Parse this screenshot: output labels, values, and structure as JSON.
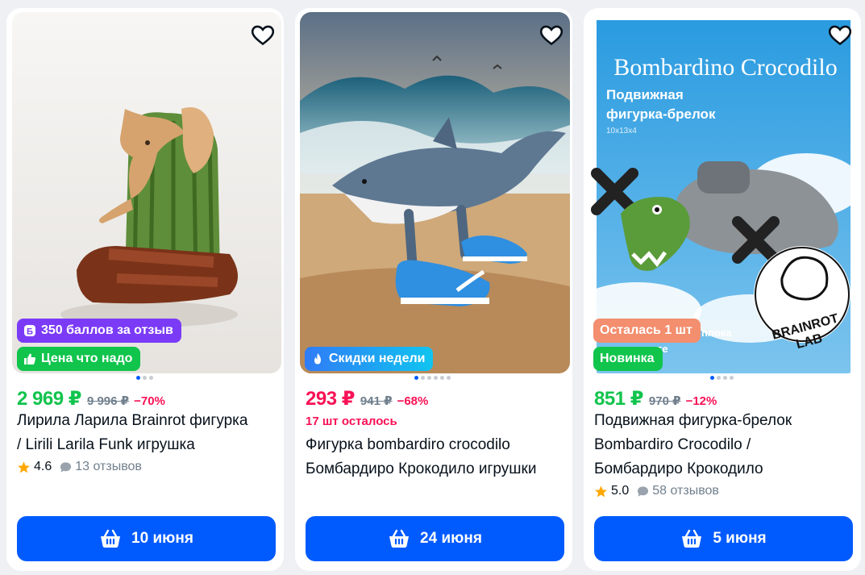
{
  "colors": {
    "accent": "#005bff",
    "price_green": "#10c44c",
    "price_pink": "#f91155",
    "badge_points": "#7b3bf6",
    "badge_good_price": "#10c44c",
    "badge_sale": "#10a7f0",
    "badge_left": "#f38e6e",
    "badge_new": "#10c44c"
  },
  "products": [
    {
      "price": "2 969 ₽",
      "old_price": "9 996 ₽",
      "discount": "−70%",
      "title_line1": "Лирила Ларила Brainrot фигурка",
      "title_line2": "/ Lirili Larila Funk игрушка",
      "rating": "4.6",
      "reviews": "13 отзывов",
      "badge_top": "350 баллов за отзыв",
      "badge_bottom": "Цена что надо",
      "delivery": "10 июня",
      "image_dots_active": 1,
      "image_dots_total": 3
    },
    {
      "price": "293 ₽",
      "old_price": "941 ₽",
      "discount": "−68%",
      "stock_left": "17 шт осталось",
      "title_line1": "Фигурка bombardiro crocodilo",
      "title_line2": "Бомбардиро Крокодило игрушки",
      "badge_bottom": "Скидки недели",
      "delivery": "24 июня",
      "image_dots_active": 1,
      "image_dots_total": 6
    },
    {
      "price": "851 ₽",
      "old_price": "970 ₽",
      "discount": "−12%",
      "title_line1": "Подвижная фигурка-брелок",
      "title_line2": "Bombardiro Crocodilo /",
      "title_line3": "Бомбардиро Крокодило",
      "rating": "5.0",
      "reviews": "58 отзывов",
      "badge_top": "Осталась 1 шт",
      "badge_bottom": "Новинка",
      "delivery": "5 июня",
      "image_dots_active": 1,
      "image_dots_total": 4,
      "image_text": {
        "heading": "Bombardino Crocodilo",
        "sub": "Подвижная фигурка-брелок",
        "size": "10x13x4",
        "logo_line1": "BRAINROT",
        "logo_line2": "LAB",
        "partial": "плока",
        "partial2": "в комплекте"
      }
    }
  ],
  "icons": {
    "favorite": "heart-outline-icon",
    "cart": "basket-icon",
    "star": "star-icon",
    "reviews": "chat-bubble-icon"
  }
}
